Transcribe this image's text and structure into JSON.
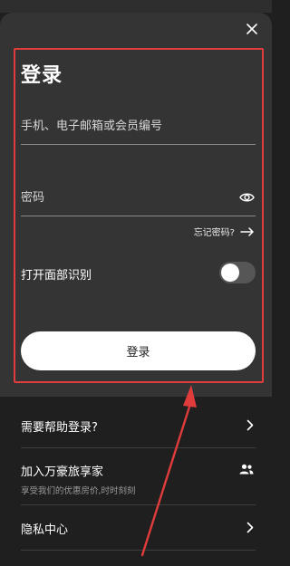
{
  "sheet": {
    "title": "登录",
    "account_placeholder": "手机、电子邮箱或会员编号",
    "password_placeholder": "密码",
    "forgot_password": "忘记密码?",
    "face_login_label": "打开面部识别",
    "face_login_enabled": false,
    "submit_label": "登录"
  },
  "menu": {
    "help": {
      "label": "需要帮助登录?"
    },
    "join": {
      "label": "加入万豪旅享家",
      "subtitle": "享受我们的优惠房价,时时刻刻"
    },
    "privacy": {
      "label": "隐私中心"
    }
  },
  "icons": {
    "close": "close-icon",
    "eye": "eye-icon",
    "forgot_arrow": "arrow-right-icon",
    "chevron": "chevron-right-icon",
    "people": "people-icon"
  },
  "colors": {
    "background": "#1f1f1f",
    "sheet": "#343434",
    "annotation_red": "#e03c3c",
    "button_fill": "#ffffff"
  }
}
